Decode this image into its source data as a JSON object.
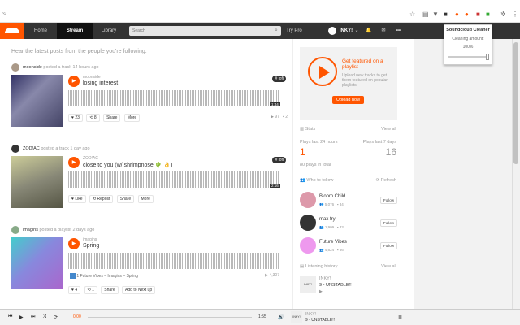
{
  "browser": {
    "tab_fragment": "rs"
  },
  "nav": {
    "home": "Home",
    "stream": "Stream",
    "library": "Library",
    "search_placeholder": "Search",
    "try_pro": "Try Pro",
    "username": "INKY!"
  },
  "extension": {
    "title": "Soundcloud Cleaner",
    "label": "Cleaning amount:",
    "value": "100%",
    "level": 1.0
  },
  "stream": {
    "headline": "Hear the latest posts from the people you're following:",
    "posts": [
      {
        "user": "moonside",
        "action": "posted a track 14 hours ago",
        "artist": "moonside",
        "title": "losing interest",
        "tag": "# lofi",
        "time": "1:44",
        "likes": "23",
        "reposts": "8",
        "share": "Share",
        "more": "More",
        "plays": "97",
        "comments": "2"
      },
      {
        "user": "ZOD!AC",
        "action": "posted a track 1 day ago",
        "artist": "ZOD!AC",
        "title": "close to you (w/ shrimpnose 🌵 👌)",
        "tag": "# lofi",
        "time": "2:16",
        "like": "Like",
        "repost": "Repost",
        "share": "Share",
        "more": "More"
      },
      {
        "user": "imagins",
        "action": "posted a playlist 2 days ago",
        "artist": "imagins",
        "title": "Spring",
        "mini": "1  Future Vibes – Imagins – Spring",
        "miniplays": "4,307",
        "likes": "4",
        "reposts": "1",
        "share": "Share",
        "addnext": "Add to Next up"
      }
    ]
  },
  "sidebar": {
    "promo_title": "Get featured on a playlist",
    "promo_text": "Upload new tracks to get them featured on popular playlists.",
    "promo_button": "Upload now",
    "stats": "Stats",
    "view_all": "View all",
    "plays24": "Plays last 24 hours",
    "plays7": "Plays last 7 days",
    "v24": "1",
    "v7": "16",
    "total": "80 plays in total",
    "who": "Who to follow",
    "refresh": "Refresh",
    "follows": [
      {
        "name": "Bloom Child",
        "followers": "5,076",
        "tracks": "34",
        "btn": "Follow"
      },
      {
        "name": "max fry",
        "followers": "1,909",
        "tracks": "33",
        "btn": "Follow"
      },
      {
        "name": "Future Vibes",
        "followers": "4,624",
        "tracks": "86",
        "btn": "Follow"
      }
    ],
    "history": "Listening history",
    "view_all2": "View all",
    "h_user": "INKY!",
    "h_track": "9 - UNSTABLE!!"
  },
  "player": {
    "elapsed": "0:00",
    "duration": "1:55",
    "user": "INKY!",
    "track": "9 - UNSTABLE!!",
    "progress": 0.0
  }
}
